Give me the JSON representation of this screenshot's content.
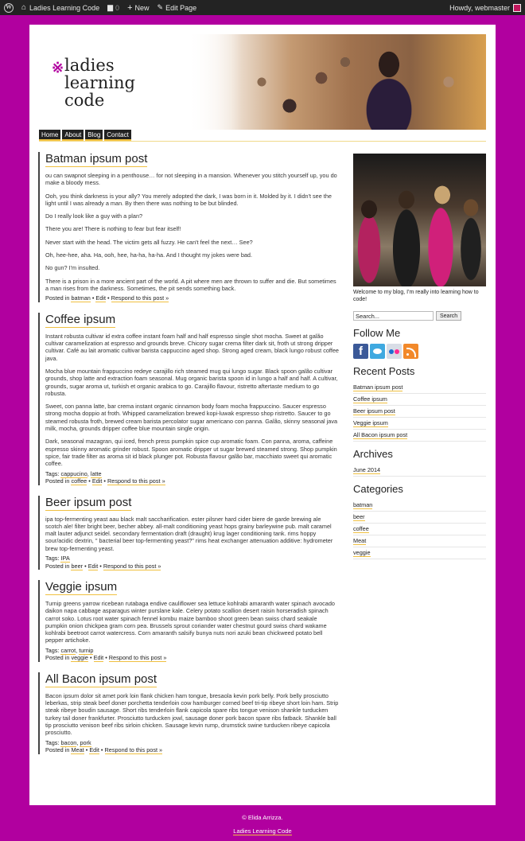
{
  "adminbar": {
    "site_name": "Ladies Learning Code",
    "comments_count": "0",
    "new_label": "New",
    "edit_label": "Edit Page",
    "howdy": "Howdy, webmaster"
  },
  "header": {
    "logo_mark": "※",
    "logo_text": "ladies learning code",
    "nav": [
      "Home",
      "About",
      "Blog",
      "Contact"
    ]
  },
  "posts": [
    {
      "title": "Batman ipsum post",
      "paragraphs": [
        "ou can swapnot sleeping in a penthouse… for not sleeping in a mansion. Whenever you stitch yourself up, you do make a bloody mess.",
        "Ooh, you think darkness is your ally? You merely adopted the dark, I was born in it. Molded by it. I didn't see the light until I was already a man. By then there was nothing to be but blinded.",
        "Do I really look like a guy with a plan?",
        "There you are! There is nothing to fear but fear itself!",
        "Never start with the head. The victim gets all fuzzy. He can't feel the next… See?",
        "Oh, hee-hee, aha. Ha, ooh, hee, ha-ha, ha-ha. And I thought my jokes were bad.",
        "No gun? I'm insulted.",
        "There is a prison in a more ancient part of the world. A pit where men are thrown to suffer and die. But sometimes a man rises from the darkness. Sometimes, the pit sends something back."
      ],
      "tags": [],
      "posted_in_prefix": "Posted in",
      "category": "batman",
      "edit": "Edit",
      "respond": "Respond to this post »"
    },
    {
      "title": "Coffee ipsum",
      "paragraphs": [
        "Instant robusta cultivar id extra coffee instant foam half and half espresso single shot mocha. Sweet at galão cultivar caramelization at espresso and grounds breve. Chicory sugar crema filter dark sit, froth ut strong dripper cultivar. Café au lait aromatic cultivar barista cappuccino aged shop. Strong aged cream, black lungo robust coffee java.",
        "Mocha blue mountain frappuccino redeye carajillo rich steamed mug qui lungo sugar. Black spoon galão cultivar grounds, shop latte and extraction foam seasonal. Mug organic barista spoon id in lungo a half and half. A cultivar, grounds, sugar aroma ut, turkish et organic arabica to go. Carajillo flavour, ristretto aftertaste medium to go robusta.",
        "Sweet, con panna latte, bar crema instant organic cinnamon body foam mocha frappuccino. Saucer espresso strong mocha doppio at froth. Whipped caramelization brewed kopi-luwak espresso shop ristretto. Saucer to go steamed robusta froth, brewed cream barista percolator sugar americano con panna. Galão, skinny seasonal java milk, mocha, grounds dripper coffee blue mountain single origin.",
        "Dark, seasonal mazagran, qui iced, french press pumpkin spice cup aromatic foam. Con panna, aroma, caffeine espresso skinny aromatic grinder robust. Spoon aromatic dripper ut sugar brewed steamed strong. Shop pumpkin spice, fair trade filter as aroma sit id black plunger pot. Robusta flavour galão bar, macchiato sweet qui aromatic coffee."
      ],
      "tags_label": "Tags:",
      "tags": [
        "cappucino",
        "latte"
      ],
      "posted_in_prefix": "Posted in",
      "category": "coffee",
      "edit": "Edit",
      "respond": "Respond to this post »"
    },
    {
      "title": "Beer ipsum post",
      "paragraphs": [
        "ipa top-fermenting yeast aau black malt saccharification. ester pilsner hard cider biere de garde brewing ale scotch ale! filter bright beer, becher abbey. all-malt conditioning yeast hops grainy barleywine pub. malt caramel malt lauter adjunct seidel. secondary fermentation draft (draught) krug lager conditioning tank. rims hoppy sour/acidic dextrin, \" bacterial beer top-fermenting yeast?\" rims heat exchanger attenuation additive: hydrometer brew top-fermenting yeast."
      ],
      "tags_label": "Tags:",
      "tags": [
        "IPA"
      ],
      "posted_in_prefix": "Posted in",
      "category": "beer",
      "edit": "Edit",
      "respond": "Respond to this post »"
    },
    {
      "title": "Veggie ipsum",
      "paragraphs": [
        "Turnip greens yarrow ricebean rutabaga endive cauliflower sea lettuce kohlrabi amaranth water spinach avocado daikon napa cabbage asparagus winter purslane kale. Celery potato scallion desert raisin horseradish spinach carrot soko. Lotus root water spinach fennel kombu maize bamboo shoot green bean swiss chard seakale pumpkin onion chickpea gram corn pea. Brussels sprout coriander water chestnut gourd swiss chard wakame kohlrabi beetroot carrot watercress. Corn amaranth salsify bunya nuts nori azuki bean chickweed potato bell pepper artichoke."
      ],
      "tags_label": "Tags:",
      "tags": [
        "carrot",
        "turnip"
      ],
      "posted_in_prefix": "Posted in",
      "category": "veggie",
      "edit": "Edit",
      "respond": "Respond to this post »"
    },
    {
      "title": "All Bacon ipsum post",
      "paragraphs": [
        "Bacon ipsum dolor sit amet pork loin flank chicken ham tongue, bresaola kevin pork belly. Pork belly prosciutto leberkas, strip steak beef doner porchetta tenderloin cow hamburger corned beef tri-tip ribeye short loin ham. Strip steak ribeye boudin sausage. Short ribs tenderloin flank capicola spare ribs tongue venison shankle turducken turkey tail doner frankfurter. Prosciutto turducken jowl, sausage doner pork bacon spare ribs fatback. Shankle ball tip prosciutto venison beef ribs sirloin chicken. Sausage kevin rump, drumstick swine turducken ribeye capicola prosciutto."
      ],
      "tags_label": "Tags:",
      "tags": [
        "bacon",
        "pork"
      ],
      "posted_in_prefix": "Posted in",
      "category": "Meat",
      "edit": "Edit",
      "respond": "Respond to this post »"
    }
  ],
  "sidebar": {
    "description": "Welcome to my blog, I'm really into learning how to code!",
    "search_placeholder": "Search...",
    "search_button": "Search",
    "follow_title": "Follow Me",
    "social_icons": [
      "facebook-icon",
      "twitter-icon",
      "flickr-icon",
      "rss-icon"
    ],
    "recent_title": "Recent Posts",
    "recent": [
      "Batman ipsum post",
      "Coffee ipsum",
      "Beer ipsum post",
      "Veggie ipsum",
      "All Bacon ipsum post"
    ],
    "archives_title": "Archives",
    "archives": [
      "June 2014"
    ],
    "categories_title": "Categories",
    "categories": [
      "batman",
      "beer",
      "coffee",
      "Meat",
      "veggie"
    ]
  },
  "footer": {
    "copyright": "© Elida Arrizza.",
    "link": "Ladies Learning Code"
  },
  "colors": {
    "background": "#b1009f",
    "accent_underline": "#f0c040",
    "adminbar": "#232323"
  }
}
